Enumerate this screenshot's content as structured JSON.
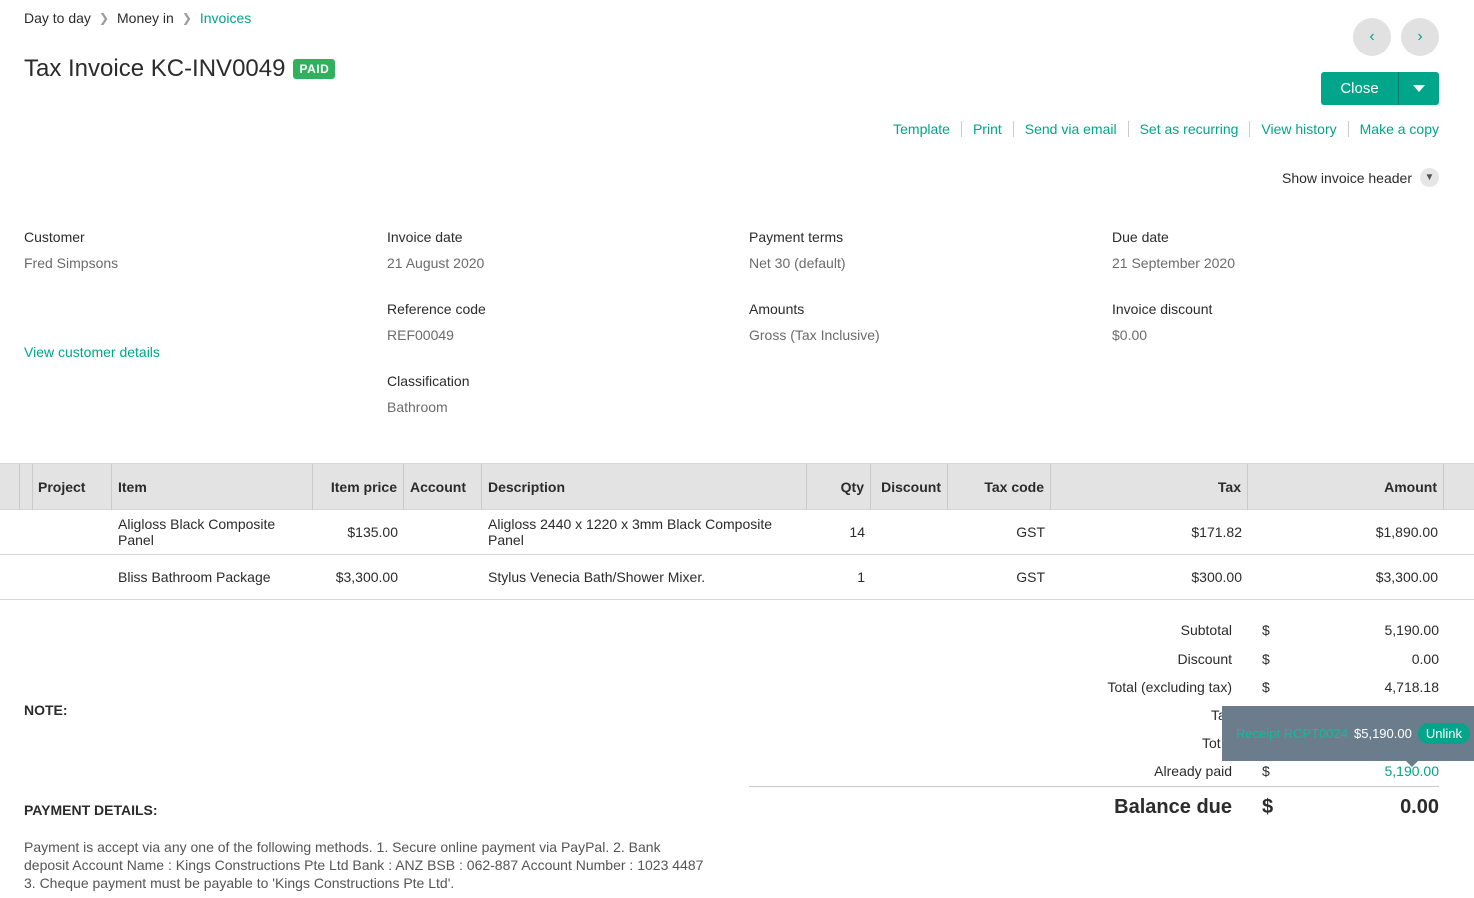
{
  "breadcrumb": {
    "items": [
      "Day to day",
      "Money in",
      "Invoices"
    ]
  },
  "header": {
    "title": "Tax Invoice KC-INV0049",
    "status_badge": "PAID",
    "close_label": "Close"
  },
  "actions": [
    "Template",
    "Print",
    "Send via email",
    "Set as recurring",
    "View history",
    "Make a copy"
  ],
  "show_invoice_header": "Show invoice header",
  "fields": {
    "customer": {
      "label": "Customer",
      "value": "Fred Simpsons"
    },
    "view_customer_details": "View customer details",
    "invoice_date": {
      "label": "Invoice date",
      "value": "21 August 2020"
    },
    "payment_terms": {
      "label": "Payment terms",
      "value": "Net 30 (default)"
    },
    "due_date": {
      "label": "Due date",
      "value": "21 September 2020"
    },
    "reference_code": {
      "label": "Reference code",
      "value": "REF00049"
    },
    "amounts": {
      "label": "Amounts",
      "value": "Gross (Tax Inclusive)"
    },
    "invoice_discount": {
      "label": "Invoice discount",
      "value": "$0.00"
    },
    "classification": {
      "label": "Classification",
      "value": "Bathroom"
    }
  },
  "table": {
    "columns": {
      "project": "Project",
      "item": "Item",
      "item_price": "Item price",
      "account": "Account",
      "description": "Description",
      "qty": "Qty",
      "discount": "Discount",
      "tax_code": "Tax code",
      "tax": "Tax",
      "amount": "Amount"
    },
    "rows": [
      {
        "item": "Aligloss Black Composite Panel",
        "item_price": "$135.00",
        "description": "Aligloss 2440 x 1220 x 3mm Black Composite Panel",
        "qty": "14",
        "tax_code": "GST",
        "tax": "$171.82",
        "amount": "$1,890.00"
      },
      {
        "item": "Bliss Bathroom Package",
        "item_price": "$3,300.00",
        "description": "Stylus Venecia Bath/Shower Mixer.",
        "qty": "1",
        "tax_code": "GST",
        "tax": "$300.00",
        "amount": "$3,300.00"
      }
    ]
  },
  "totals": {
    "currency": "$",
    "subtotal": {
      "label": "Subtotal",
      "value": "5,190.00"
    },
    "discount": {
      "label": "Discount",
      "value": "0.00"
    },
    "total_ex_tax": {
      "label": "Total (excluding tax)",
      "value": "4,718.18"
    },
    "tax": {
      "label": "Ta"
    },
    "total": {
      "label": "Tot"
    },
    "already_paid": {
      "label": "Already paid",
      "value": "5,190.00"
    },
    "balance_due": {
      "label": "Balance due",
      "value": "0.00"
    }
  },
  "tooltip": {
    "receipt": "Receipt RCPT0024",
    "amount": "$5,190.00",
    "unlink": "Unlink"
  },
  "note_label": "NOTE:",
  "payment_details_label": "PAYMENT DETAILS:",
  "payment_details_text": "Payment is accept via any one of the following methods. 1. Secure online payment via PayPal. 2. Bank deposit Account Name : Kings Constructions Pte Ltd Bank : ANZ BSB : 062-887 Account Number : 1023 4487 3. Cheque payment must be payable to 'Kings Constructions Pte Ltd'."
}
